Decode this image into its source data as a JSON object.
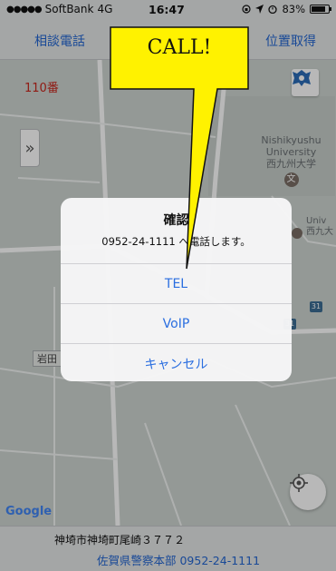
{
  "status_bar": {
    "signal": "●●●●●",
    "carrier": "SoftBank",
    "network": "4G",
    "time": "16:47",
    "battery": "83%",
    "battery_level": 0.83
  },
  "nav": {
    "left_label": "相談電話",
    "right_label": "位置取得"
  },
  "map": {
    "label_110": "110番",
    "university_en": "Nishikyushu University",
    "university_ja": "西九州大学",
    "university_badge": "文",
    "univ2": "Univ",
    "univ2_ja": "西九大",
    "route_31": "31",
    "route_31b": "31",
    "iwata": "岩田",
    "expand_glyph": "»",
    "google": "Google"
  },
  "alert": {
    "title": "確認",
    "message": "0952-24-1111 へ電話します。",
    "actions": [
      {
        "label": "TEL"
      },
      {
        "label": "VoIP"
      },
      {
        "label": "キャンセル"
      }
    ]
  },
  "callout": {
    "text": "CALL!",
    "fill": "#fff200"
  },
  "bottom": {
    "address": "神埼市神埼町尾崎３７７２",
    "station": "佐賀県警察本部 0952-24-1111"
  },
  "colors": {
    "link_blue": "#2366d1",
    "alert_blue": "#2a6ee0",
    "label_red": "#c8261c"
  }
}
